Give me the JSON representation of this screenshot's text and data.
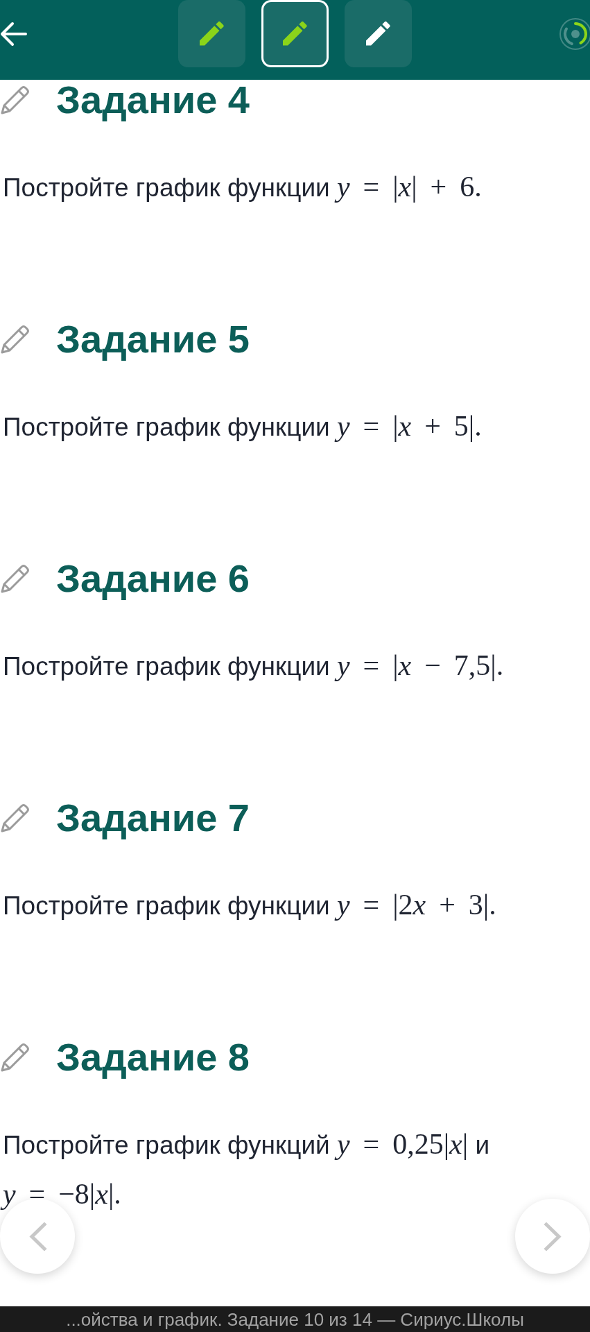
{
  "header": {
    "task_tiles": [
      {
        "selected": false,
        "color": "#8bd41a"
      },
      {
        "selected": true,
        "color": "#8bd41a"
      },
      {
        "selected": false,
        "color": "#ffffff"
      }
    ]
  },
  "tasks": [
    {
      "title": "Задание 4",
      "statement": [
        {
          "kind": "text",
          "text": "Постройте график функции"
        },
        {
          "kind": "math",
          "text": "*y* = |*x*| + 6."
        }
      ]
    },
    {
      "title": "Задание 5",
      "statement": [
        {
          "kind": "text",
          "text": "Постройте график функции"
        },
        {
          "kind": "math",
          "text": "*y* = |*x* + 5|."
        }
      ]
    },
    {
      "title": "Задание 6",
      "statement": [
        {
          "kind": "text",
          "text": "Постройте график функции"
        },
        {
          "kind": "math",
          "text": "*y* = |*x* − 7,5|."
        }
      ]
    },
    {
      "title": "Задание 7",
      "statement": [
        {
          "kind": "text",
          "text": "Постройте график функции"
        },
        {
          "kind": "math",
          "text": "*y* = |2"
        },
        {
          "kind": "math",
          "text": "*x* + 3|."
        }
      ]
    },
    {
      "title": "Задание 8",
      "statement": [
        {
          "kind": "text",
          "text": "Постройте график функций"
        },
        {
          "kind": "math",
          "text": "*y* = 0,25|*x*|"
        },
        {
          "kind": "text",
          "text": "и"
        },
        {
          "kind": "math",
          "text": "*y* = −8|*x*|."
        }
      ]
    }
  ],
  "footer": {
    "title": "...ойства и график. Задание 10 из 14 — Сириус.Школы"
  }
}
